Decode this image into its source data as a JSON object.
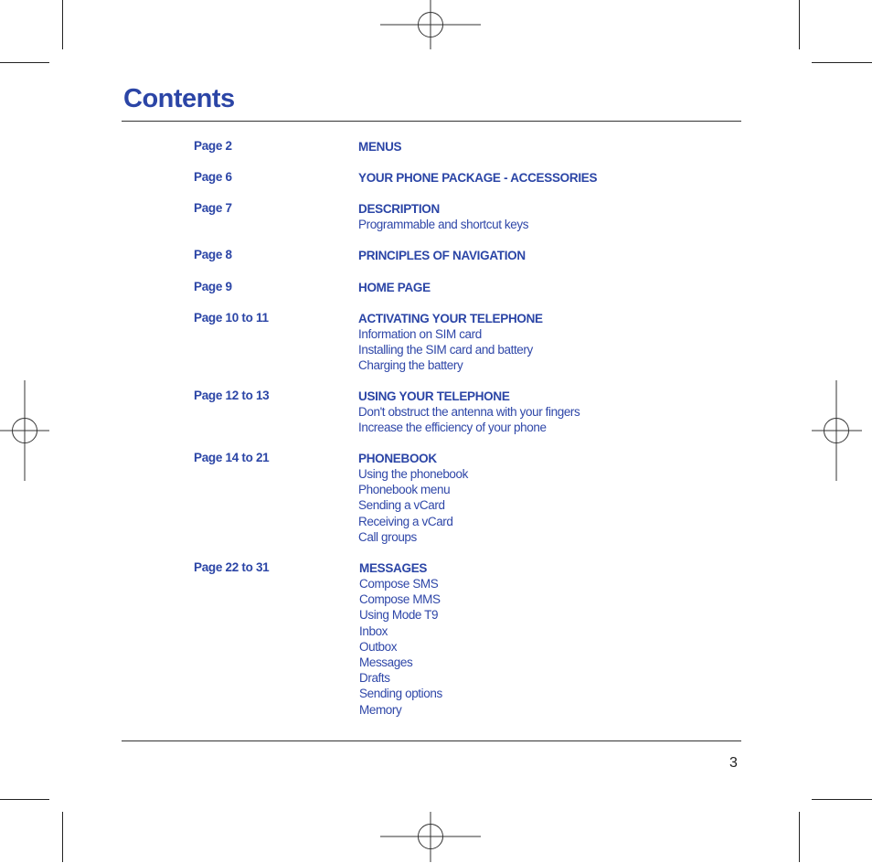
{
  "title": "Contents",
  "page_number": "3",
  "entries": [
    {
      "page": "Page 2",
      "heading": "MENUS",
      "items": []
    },
    {
      "page": "Page 6",
      "heading": "YOUR PHONE PACKAGE - ACCESSORIES",
      "items": []
    },
    {
      "page": "Page 7",
      "heading": "DESCRIPTION",
      "items": [
        "Programmable and shortcut keys"
      ]
    },
    {
      "page": "Page 8",
      "heading": "PRINCIPLES OF NAVIGATION",
      "items": []
    },
    {
      "page": "Page 9",
      "heading": "HOME PAGE",
      "items": []
    },
    {
      "page": "Page 10 to 11",
      "heading": "ACTIVATING YOUR TELEPHONE",
      "items": [
        "Information on SIM card",
        "Installing the SIM card and battery",
        "Charging the battery"
      ]
    },
    {
      "page": "Page 12 to 13",
      "heading": "USING YOUR TELEPHONE",
      "items": [
        "Don't obstruct the antenna with your fingers",
        "Increase the efficiency of your phone"
      ]
    },
    {
      "page": "Page 14 to 21",
      "heading": "PHONEBOOK",
      "items": [
        "Using the phonebook",
        "Phonebook menu",
        "Sending a vCard",
        "Receiving a vCard",
        "Call groups"
      ]
    },
    {
      "page": "Page 22 to 31",
      "heading": "MESSAGES",
      "items": [
        "Compose SMS",
        "Compose MMS",
        "Using Mode T9",
        "Inbox",
        "Outbox",
        "Messages",
        "Drafts",
        "Sending options",
        "Memory"
      ]
    }
  ]
}
